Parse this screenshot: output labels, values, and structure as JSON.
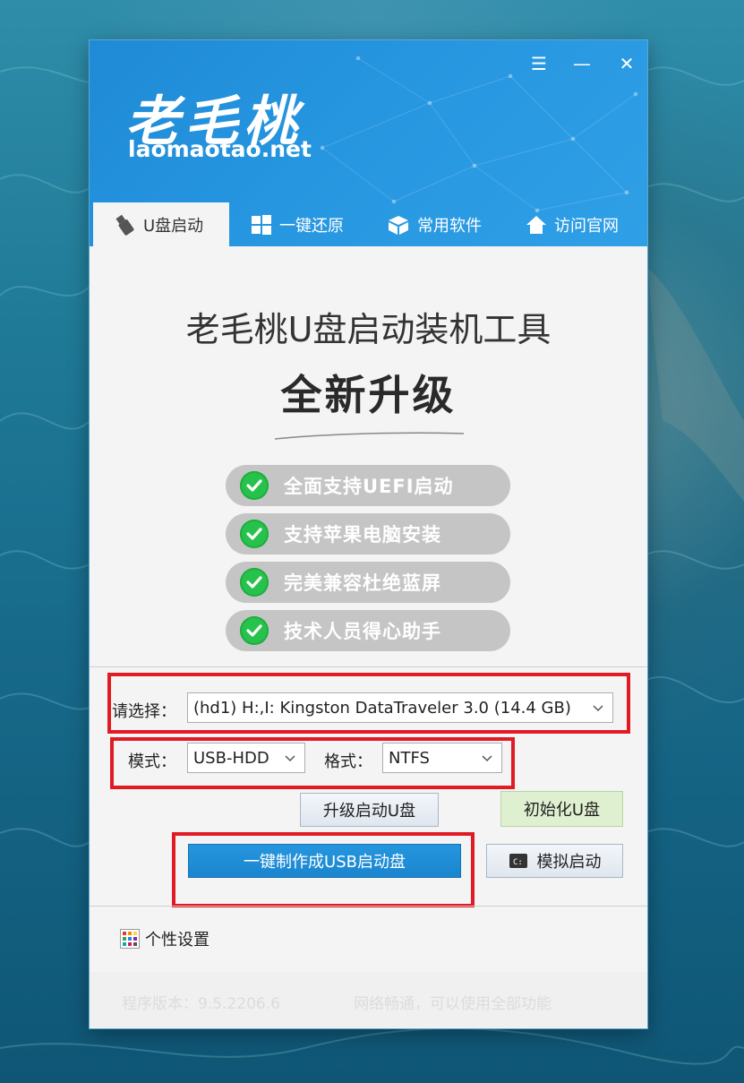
{
  "window_controls": {
    "menu": "☰",
    "minimize": "—",
    "close": "✕"
  },
  "logo": {
    "cn": "老毛桃",
    "en": "laomaotao.net"
  },
  "tabs": [
    {
      "label": "U盘启动",
      "icon": "usb-icon",
      "active": true
    },
    {
      "label": "一键还原",
      "icon": "windows-icon",
      "active": false
    },
    {
      "label": "常用软件",
      "icon": "box-icon",
      "active": false
    },
    {
      "label": "访问官网",
      "icon": "home-icon",
      "active": false
    }
  ],
  "hero": {
    "title": "老毛桃U盘启动装机工具",
    "subtitle": "全新升级",
    "features": [
      "全面支持UEFI启动",
      "支持苹果电脑安装",
      "完美兼容杜绝蓝屏",
      "技术人员得心助手"
    ]
  },
  "form": {
    "device_label": "请选择：",
    "device_value": "(hd1) H:,I: Kingston DataTraveler 3.0 (14.4 GB)",
    "mode_label": "模式：",
    "mode_value": "USB-HDD",
    "format_label": "格式：",
    "format_value": "NTFS"
  },
  "buttons": {
    "upgrade": "升级启动U盘",
    "init": "初始化U盘",
    "make": "一键制作成USB启动盘",
    "simulate": "模拟启动"
  },
  "settings_label": "个性设置",
  "footer": {
    "version": "程序版本：9.5.2206.6",
    "network": "网络畅通，可以使用全部功能"
  },
  "colors": {
    "header_blue": "#2696e0",
    "make_button": "#1e8fd8",
    "init_button": "#dff0d0",
    "highlight_red": "#e01b24",
    "check_green": "#27c24b"
  }
}
